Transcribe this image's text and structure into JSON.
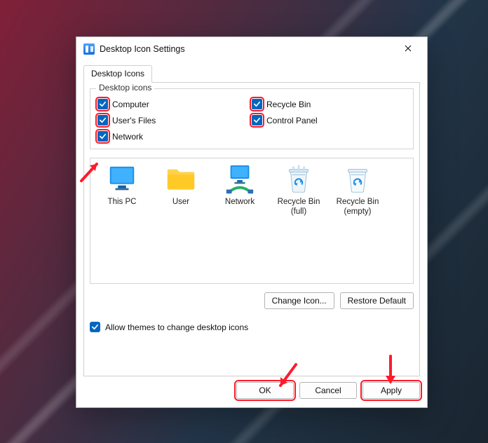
{
  "window": {
    "title": "Desktop Icon Settings"
  },
  "tab": {
    "label": "Desktop Icons"
  },
  "group": {
    "title": "Desktop icons",
    "checks": {
      "computer": "Computer",
      "users_files": "User's Files",
      "network": "Network",
      "recycle_bin": "Recycle Bin",
      "control_panel": "Control Panel"
    }
  },
  "preview": {
    "this_pc": "This PC",
    "user": "User",
    "network": "Network",
    "recycle_full": "Recycle Bin (full)",
    "recycle_empty": "Recycle Bin (empty)"
  },
  "buttons": {
    "change_icon": "Change Icon...",
    "restore_default": "Restore Default",
    "ok": "OK",
    "cancel": "Cancel",
    "apply": "Apply"
  },
  "allow_themes": {
    "label": "Allow themes to change desktop icons"
  }
}
